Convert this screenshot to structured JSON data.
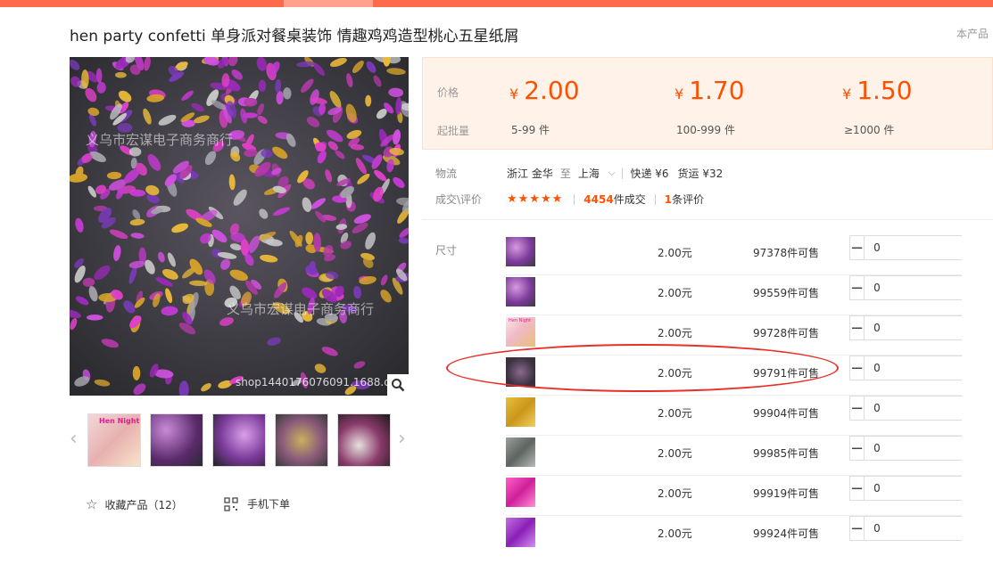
{
  "product": {
    "title": "hen party confetti 单身派对餐桌装饰 情趣鸡鸡造型桃心五星纸屑",
    "corner_note": "本产品"
  },
  "gallery": {
    "watermark1": "义乌市宏谋电子商务商行",
    "watermark2": "义乌市宏谋电子商务商行",
    "watermark3": "shop1440176076091.1688.co",
    "thumb1_label": "Hen Night"
  },
  "actions": {
    "favorite": "收藏产品（12）",
    "mobile_order": "手机下单"
  },
  "pricing": {
    "price_label": "价格",
    "moq_label": "起批量",
    "currency": "¥",
    "tiers": [
      {
        "price": "2.00",
        "qty": "5-99 件"
      },
      {
        "price": "1.70",
        "qty": "100-999 件"
      },
      {
        "price": "1.50",
        "qty": "≥1000 件"
      }
    ]
  },
  "logistics": {
    "label": "物流",
    "from": "浙江 金华",
    "to_word": "至",
    "to": "上海",
    "express": "快递 ¥6",
    "freight": "货运 ¥32"
  },
  "deals": {
    "label": "成交\\评价",
    "stars": "★★★★★",
    "count": "4454",
    "count_suffix": "件成交",
    "reviews": "1",
    "reviews_suffix": "条评价"
  },
  "sku": {
    "label": "尺寸",
    "rows": [
      {
        "price": "2.00元",
        "stock": "97378件可售",
        "qty": "0"
      },
      {
        "price": "2.00元",
        "stock": "99559件可售",
        "qty": "0"
      },
      {
        "price": "2.00元",
        "stock": "99728件可售",
        "qty": "0",
        "thumb_label": "Hen Night"
      },
      {
        "price": "2.00元",
        "stock": "99791件可售",
        "qty": "0"
      },
      {
        "price": "2.00元",
        "stock": "99904件可售",
        "qty": "0"
      },
      {
        "price": "2.00元",
        "stock": "99985件可售",
        "qty": "0"
      },
      {
        "price": "2.00元",
        "stock": "99919件可售",
        "qty": "0"
      },
      {
        "price": "2.00元",
        "stock": "99924件可售",
        "qty": "0"
      }
    ]
  },
  "colors": {
    "accent": "#ff5000",
    "topbar": "#ff6a4d",
    "highlight_ring": "#e8302a"
  }
}
